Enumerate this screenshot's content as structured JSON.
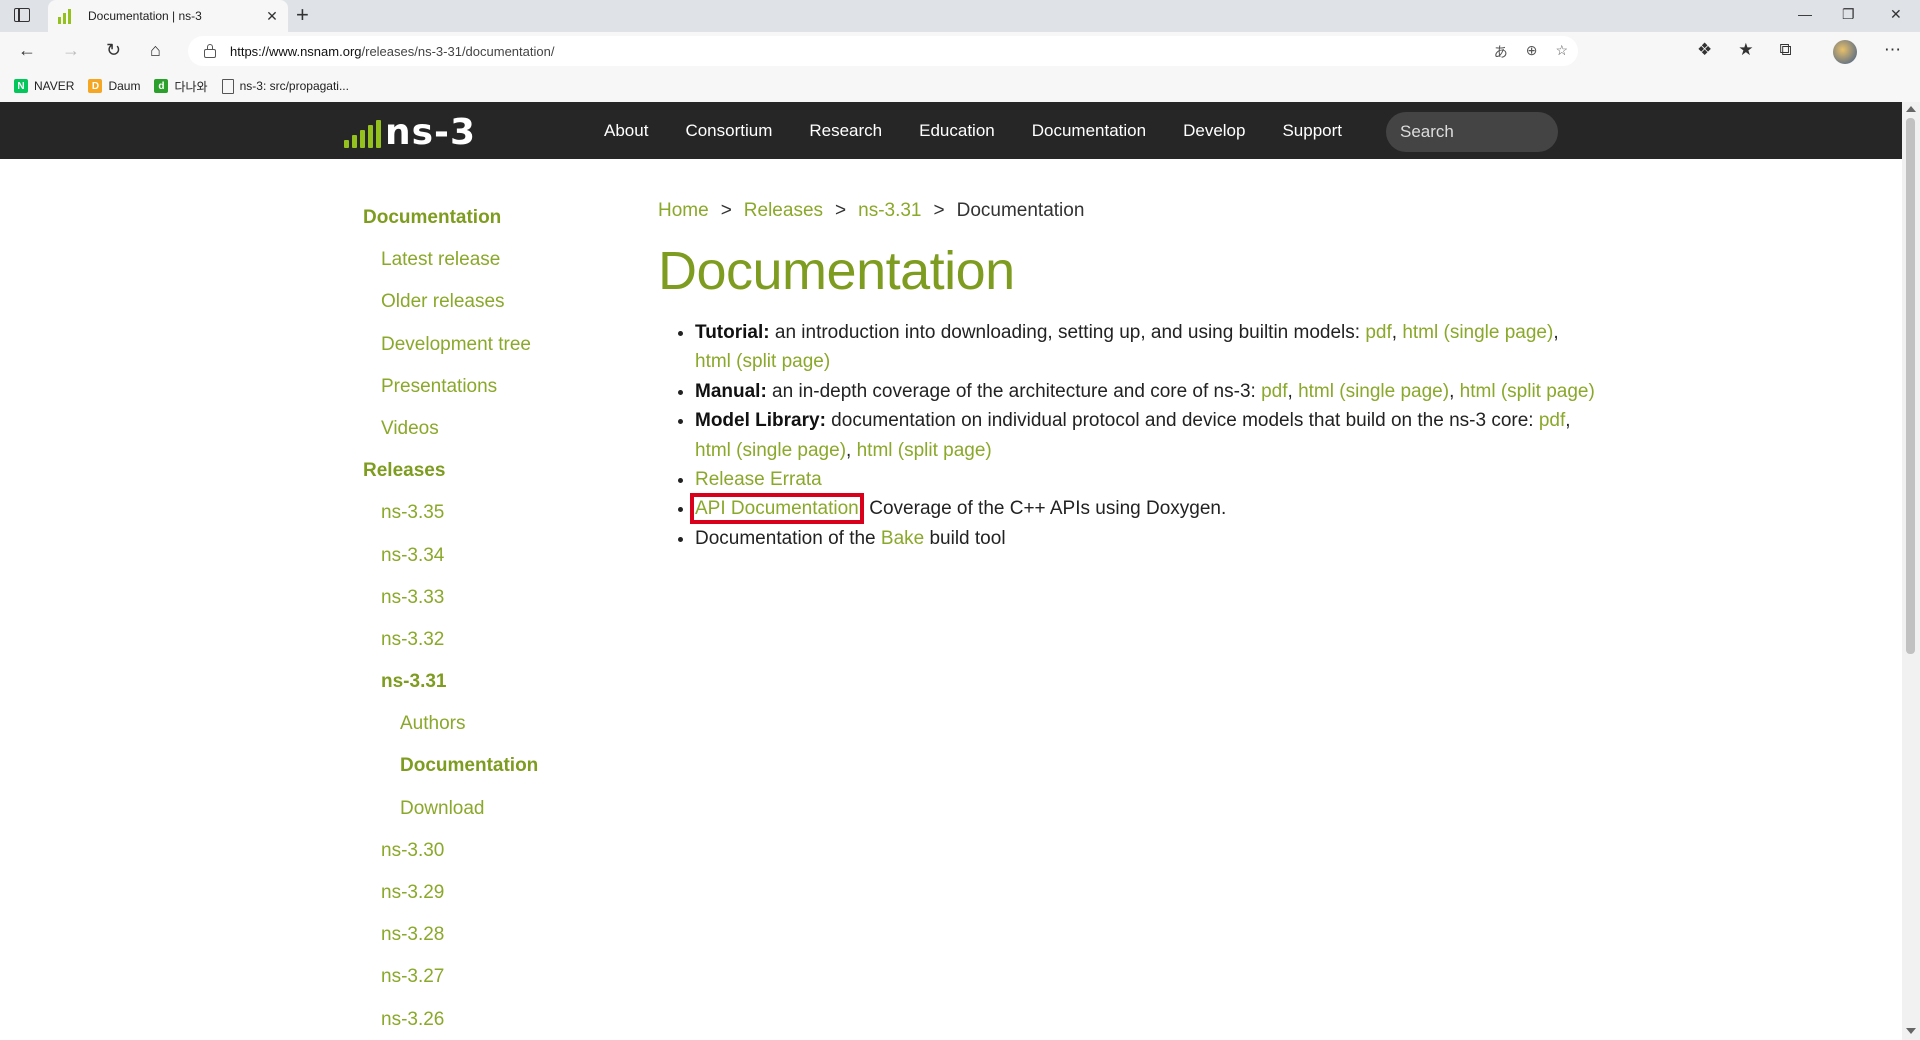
{
  "browser": {
    "tab_title": "Documentation | ns-3",
    "new_tab_symbol": "+",
    "tab_close_symbol": "✕",
    "url_host": "https://www.nsnam.org",
    "url_path": "/releases/ns-3-31/documentation/",
    "bookmarks": [
      {
        "label": "NAVER",
        "icon": "naver-icon",
        "icon_text": "N",
        "color": "#03c75a"
      },
      {
        "label": "Daum",
        "icon": "daum-icon",
        "icon_text": "D",
        "color": "#f5a623"
      },
      {
        "label": "다나와",
        "icon": "danawa-icon",
        "icon_text": "d",
        "color": "#2ca02c"
      },
      {
        "label": "ns-3: src/propagati...",
        "icon": "page-icon",
        "icon_text": "",
        "color": ""
      }
    ]
  },
  "header": {
    "logo_text": "ns-3",
    "nav": [
      "About",
      "Consortium",
      "Research",
      "Education",
      "Documentation",
      "Develop",
      "Support"
    ],
    "search_placeholder": "Search"
  },
  "sidebar": {
    "documentation_heading": "Documentation",
    "documentation_items": [
      "Latest release",
      "Older releases",
      "Development tree",
      "Presentations",
      "Videos"
    ],
    "releases_heading": "Releases",
    "releases_before": [
      "ns-3.35",
      "ns-3.34",
      "ns-3.33",
      "ns-3.32"
    ],
    "current_release": "ns-3.31",
    "current_subitems": [
      "Authors",
      "Documentation",
      "Download"
    ],
    "current_subitem_active": "Documentation",
    "releases_after": [
      "ns-3.30",
      "ns-3.29",
      "ns-3.28",
      "ns-3.27",
      "ns-3.26"
    ]
  },
  "breadcrumb": {
    "items": [
      "Home",
      "Releases",
      "ns-3.31"
    ],
    "current": "Documentation",
    "separator": ">"
  },
  "main": {
    "title": "Documentation",
    "tutorial": {
      "label": "Tutorial:",
      "text": " an introduction into downloading, setting up, and using builtin models: ",
      "links": [
        "pdf",
        "html (single page)",
        "html (split page)"
      ]
    },
    "manual": {
      "label": "Manual:",
      "text": " an in-depth coverage of the architecture and core of ns-3: ",
      "links": [
        "pdf",
        "html (single page)",
        "html (split page)"
      ]
    },
    "model_library": {
      "label": "Model Library:",
      "text": " documentation on individual protocol and device models that build on the ns-3 core: ",
      "links": [
        "pdf",
        "html (single page)",
        "html (split page)"
      ]
    },
    "release_errata": "Release Errata",
    "api_doc": {
      "link": "API Documentation",
      "text": ": Coverage of the C++ APIs using Doxygen."
    },
    "bake": {
      "prefix": "Documentation of the ",
      "link": "Bake",
      "suffix": " build tool"
    },
    "comma": ", "
  },
  "colors": {
    "accent": "#8aa82a",
    "header_bg": "#262626",
    "highlight": "#d9001b"
  }
}
